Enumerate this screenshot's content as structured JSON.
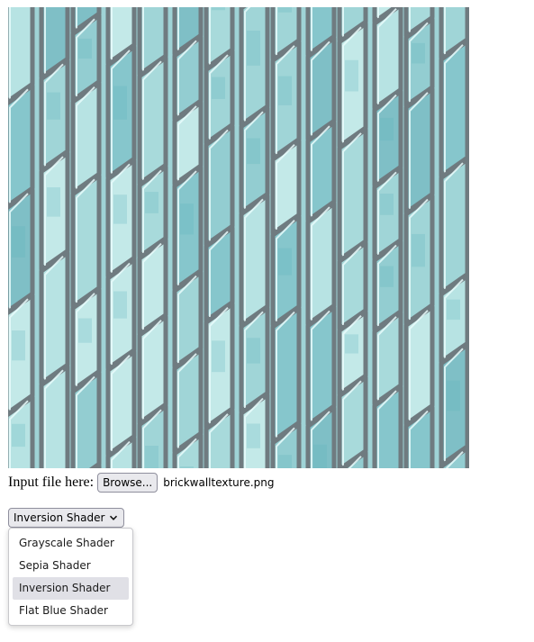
{
  "image": {
    "description_icon": "brick-wall-texture-image",
    "palette": {
      "base": "#9fd3d6",
      "mortar": "#6f7b80",
      "highlight": "#e9fbfb",
      "deep": "#5cb3bb"
    }
  },
  "file_input": {
    "label": "Input file here:",
    "button_label": "Browse...",
    "file_name": "brickwalltexture.png"
  },
  "shader_select": {
    "selected": "Inversion Shader",
    "options": [
      "Grayscale Shader",
      "Sepia Shader",
      "Inversion Shader",
      "Flat Blue Shader"
    ]
  }
}
